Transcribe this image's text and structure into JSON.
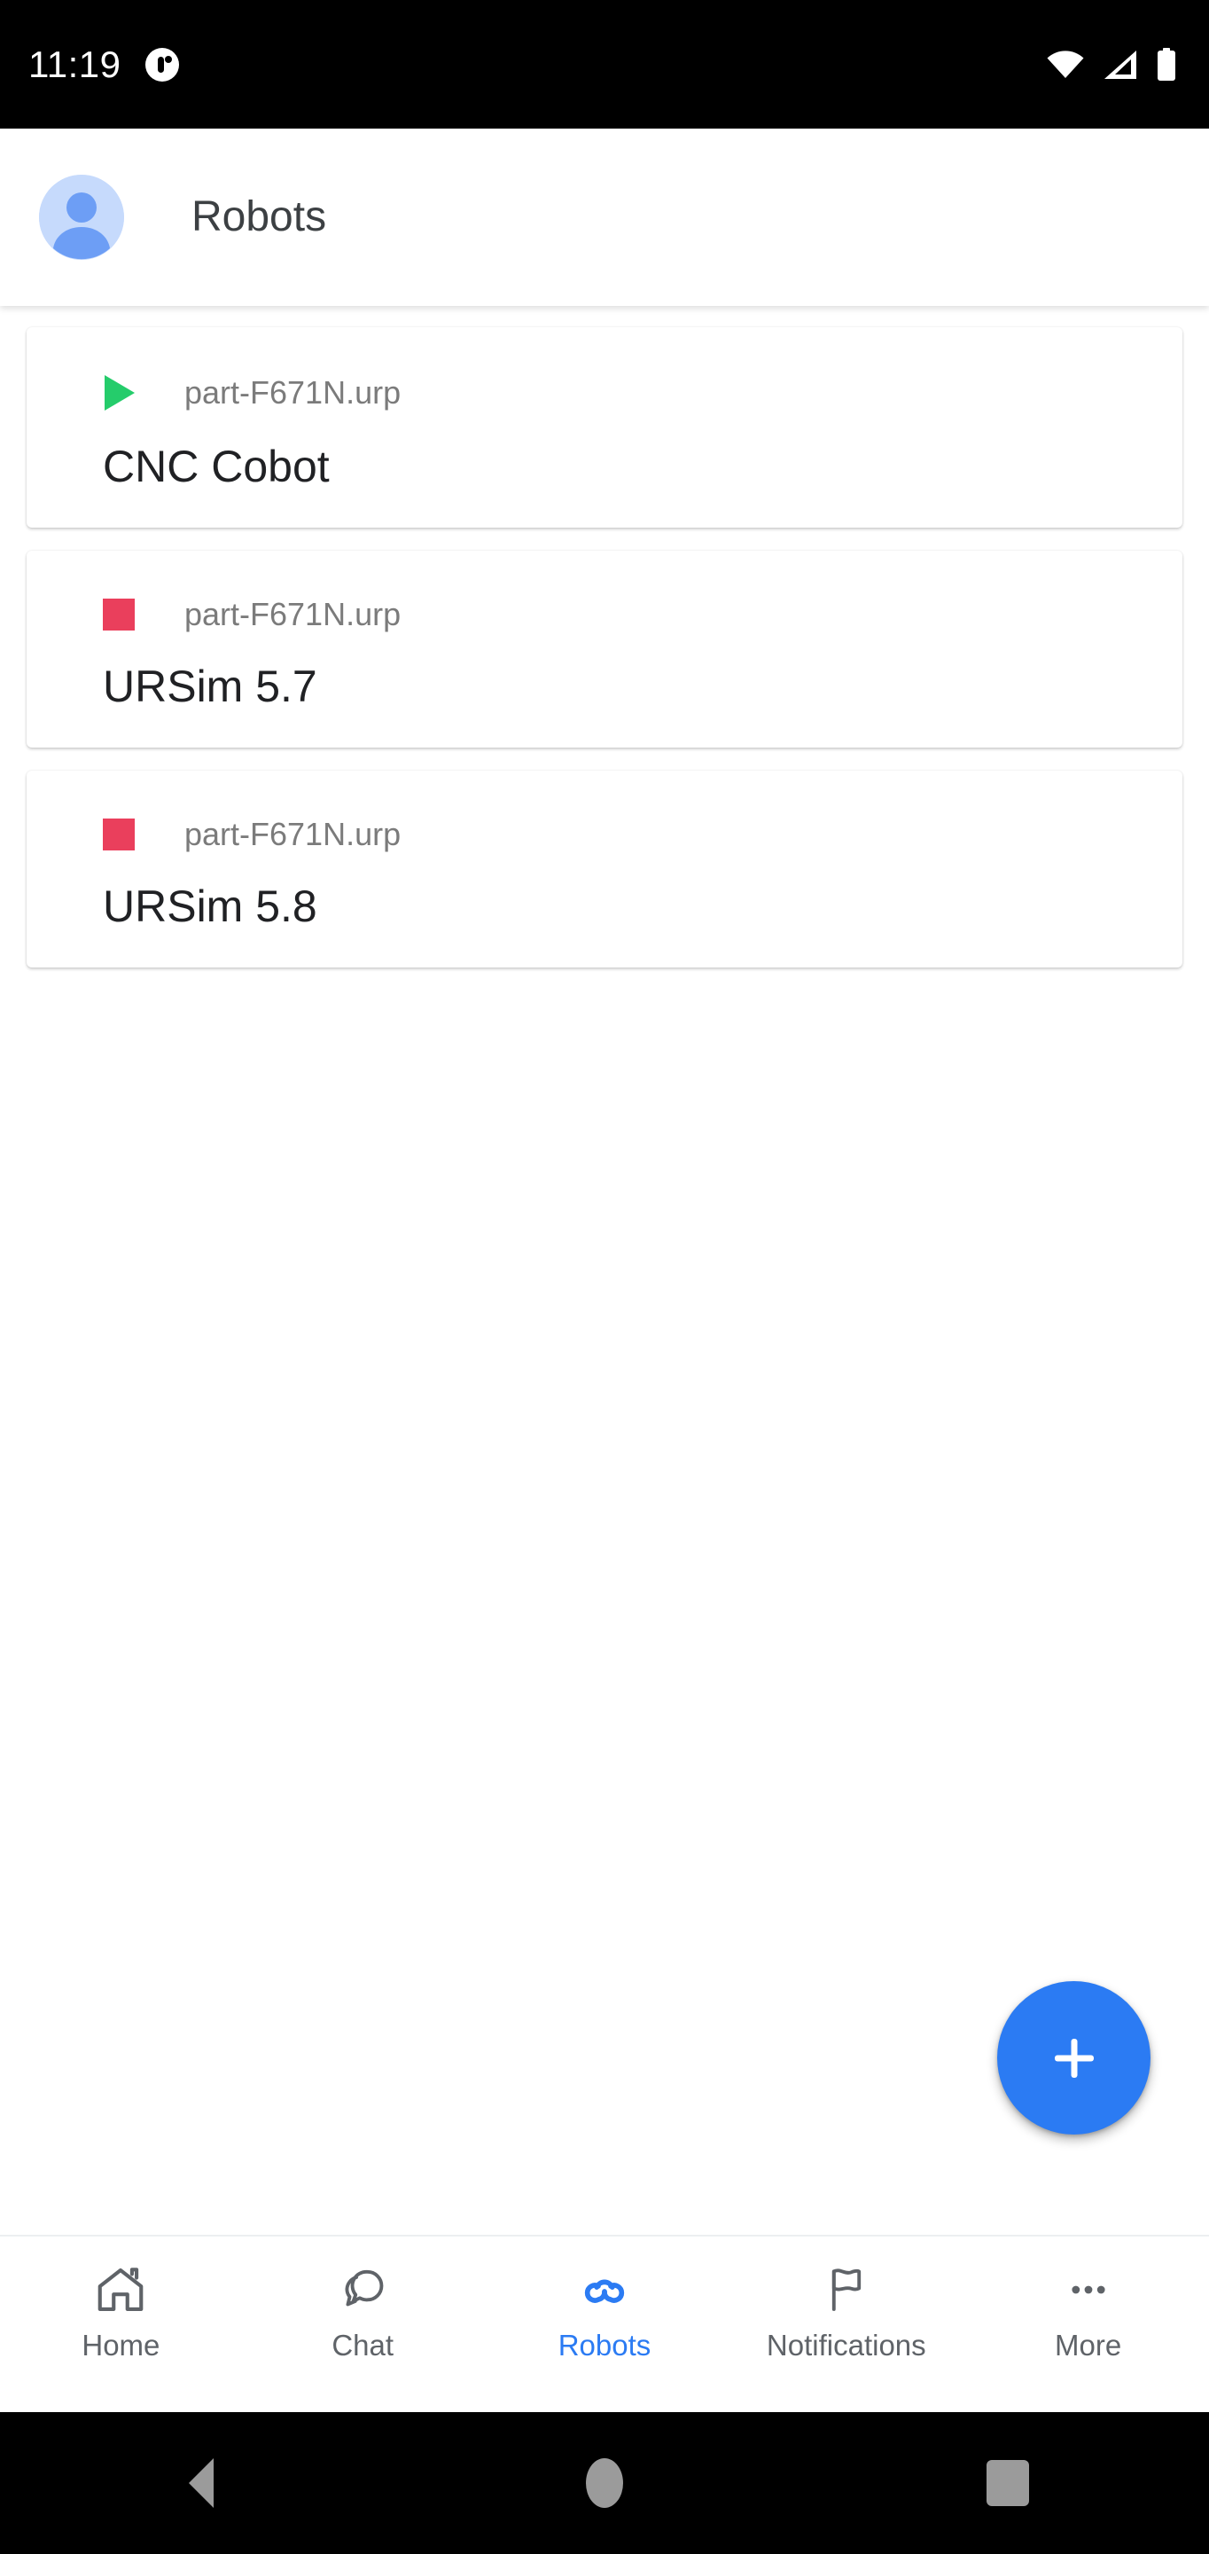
{
  "status_bar": {
    "clock": "11:19",
    "notification_icon": "app-notification-badge-icon",
    "wifi_icon": "wifi-full-icon",
    "cellular_icon": "cellular-signal-icon",
    "battery_icon": "battery-full-icon",
    "background_color": "#000000",
    "foreground_color": "#ffffff"
  },
  "app_bar": {
    "title": "Robots",
    "avatar_icon": "account-avatar-icon",
    "avatar_bg_color": "#c6dafc",
    "avatar_fg_color": "#6d9ef5",
    "title_color": "#3c4043"
  },
  "robots": [
    {
      "status_icon": "play-icon",
      "status_color": "#25cc6b",
      "status": "running",
      "program": "part-F671N.urp",
      "name": "CNC Cobot"
    },
    {
      "status_icon": "stop-icon",
      "status_color": "#ea3f5c",
      "status": "stopped",
      "program": "part-F671N.urp",
      "name": "URSim 5.7"
    },
    {
      "status_icon": "stop-icon",
      "status_color": "#ea3f5c",
      "status": "stopped",
      "program": "part-F671N.urp",
      "name": "URSim 5.8"
    }
  ],
  "fab": {
    "label": "+",
    "icon": "plus-icon",
    "color": "#2b7bf3"
  },
  "bottom_nav": {
    "active_index": 2,
    "active_color": "#2b7bf3",
    "inactive_color": "#5f6368",
    "items": [
      {
        "label": "Home",
        "icon": "home-icon"
      },
      {
        "label": "Chat",
        "icon": "chat-bubble-icon"
      },
      {
        "label": "Robots",
        "icon": "robots-loop-icon"
      },
      {
        "label": "Notifications",
        "icon": "flag-icon"
      },
      {
        "label": "More",
        "icon": "more-horizontal-icon"
      }
    ]
  },
  "system_nav": {
    "back": "back-triangle-icon",
    "home": "home-circle-icon",
    "recents": "recents-square-icon",
    "color": "#9b9b9b"
  }
}
